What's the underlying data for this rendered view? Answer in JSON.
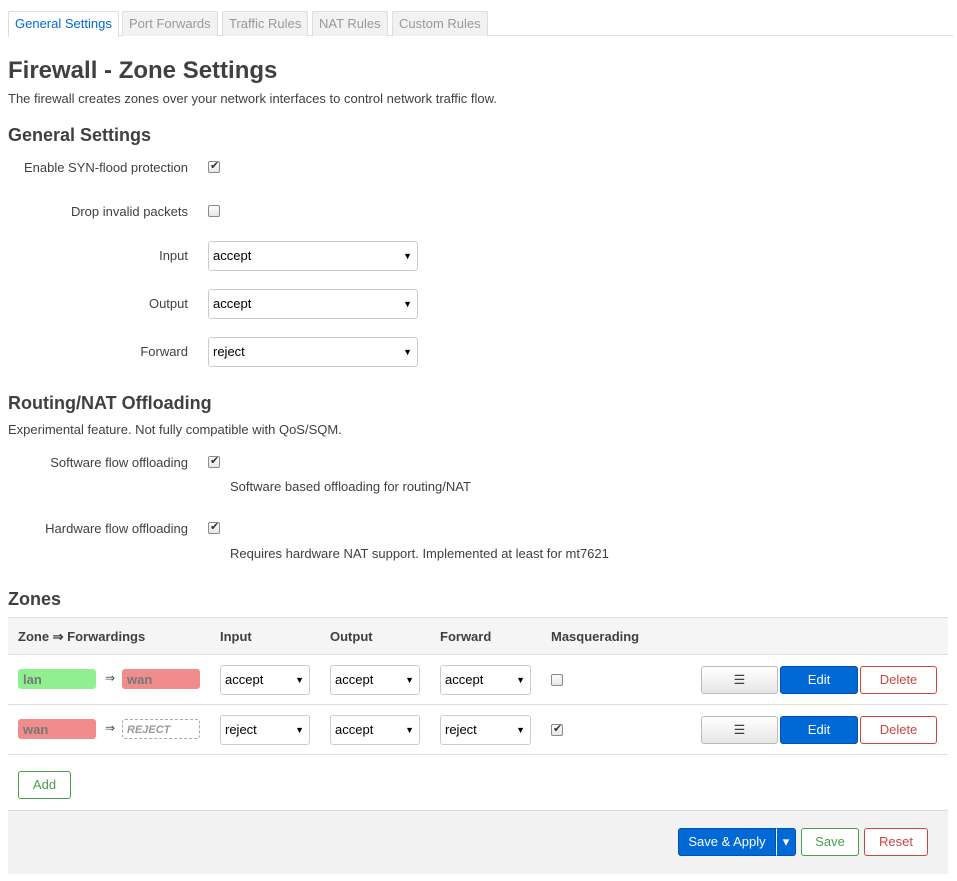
{
  "tabs": [
    {
      "label": "General Settings",
      "active": true
    },
    {
      "label": "Port Forwards"
    },
    {
      "label": "Traffic Rules"
    },
    {
      "label": "NAT Rules"
    },
    {
      "label": "Custom Rules"
    }
  ],
  "page": {
    "title": "Firewall - Zone Settings",
    "description": "The firewall creates zones over your network interfaces to control network traffic flow."
  },
  "general": {
    "heading": "General Settings",
    "syn_flood_label": "Enable SYN-flood protection",
    "syn_flood_checked": true,
    "drop_invalid_label": "Drop invalid packets",
    "drop_invalid_checked": false,
    "input_label": "Input",
    "input_value": "accept",
    "output_label": "Output",
    "output_value": "accept",
    "forward_label": "Forward",
    "forward_value": "reject"
  },
  "offloading": {
    "heading": "Routing/NAT Offloading",
    "description": "Experimental feature. Not fully compatible with QoS/SQM.",
    "software_label": "Software flow offloading",
    "software_checked": true,
    "software_hint": "Software based offloading for routing/NAT",
    "hardware_label": "Hardware flow offloading",
    "hardware_checked": true,
    "hardware_hint": "Requires hardware NAT support. Implemented at least for mt7621"
  },
  "zones": {
    "heading": "Zones",
    "columns": {
      "zone": "Zone ⇒ Forwardings",
      "input": "Input",
      "output": "Output",
      "forward": "Forward",
      "masq": "Masquerading"
    },
    "arrow": "⇒",
    "rows": [
      {
        "zone": "lan",
        "dest": "wan",
        "input": "accept",
        "output": "accept",
        "forward": "accept",
        "masq": false
      },
      {
        "zone": "wan",
        "dest": "REJECT",
        "input": "reject",
        "output": "accept",
        "forward": "reject",
        "masq": true
      }
    ],
    "menu_icon": "☰",
    "edit_label": "Edit",
    "delete_label": "Delete",
    "add_label": "Add"
  },
  "footer": {
    "save_apply_label": "Save & Apply",
    "dropdown_icon": "▾",
    "save_label": "Save",
    "reset_label": "Reset"
  },
  "colors": {
    "accent": "#0069d6",
    "zone_green": "#90f090",
    "zone_red": "#f08c8c",
    "danger": "#cc4444",
    "positive": "#4a9e4a"
  }
}
